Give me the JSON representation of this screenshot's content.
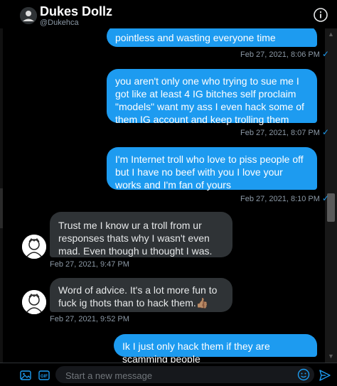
{
  "header": {
    "name": "Dukes Dollz",
    "handle": "@Dukehca"
  },
  "messages": [
    {
      "direction": "out",
      "text": "pointless and wasting everyone time",
      "time": "Feb 27, 2021, 8:06 PM",
      "seen": "✓"
    },
    {
      "direction": "out",
      "text": "you aren't only one who trying to sue me I got like at least 4 IG bitches self proclaim \"models\" want my ass I even hack some of them IG account and keep trolling them",
      "time": "Feb 27, 2021, 8:07 PM",
      "seen": "✓"
    },
    {
      "direction": "out",
      "text": "I'm Internet troll who love to piss people off but I have no beef with you I love your works and I'm fan of yours",
      "time": "Feb 27, 2021, 8:10 PM",
      "seen": "✓"
    },
    {
      "direction": "in",
      "text": "Trust me I know ur a troll from ur responses thats why I wasn't even mad. Even though u thought I was.",
      "time": "Feb 27, 2021, 9:47 PM"
    },
    {
      "direction": "in",
      "text": "Word of advice. It's a lot more fun to fuck ig thots than to hack them.👍🏽",
      "time": "Feb 27, 2021, 9:52 PM"
    },
    {
      "direction": "out",
      "text": "Ik I just only hack them if they are scamming people",
      "time": "",
      "seen": ""
    }
  ],
  "composer": {
    "placeholder": "Start a new message",
    "gif_label": "GIF"
  },
  "colors": {
    "accent": "#1d9bf0",
    "incoming_bubble": "#2f3336",
    "background": "#000000"
  },
  "icons": [
    "info-icon",
    "media-icon",
    "gif-icon",
    "emoji-icon",
    "send-icon"
  ]
}
